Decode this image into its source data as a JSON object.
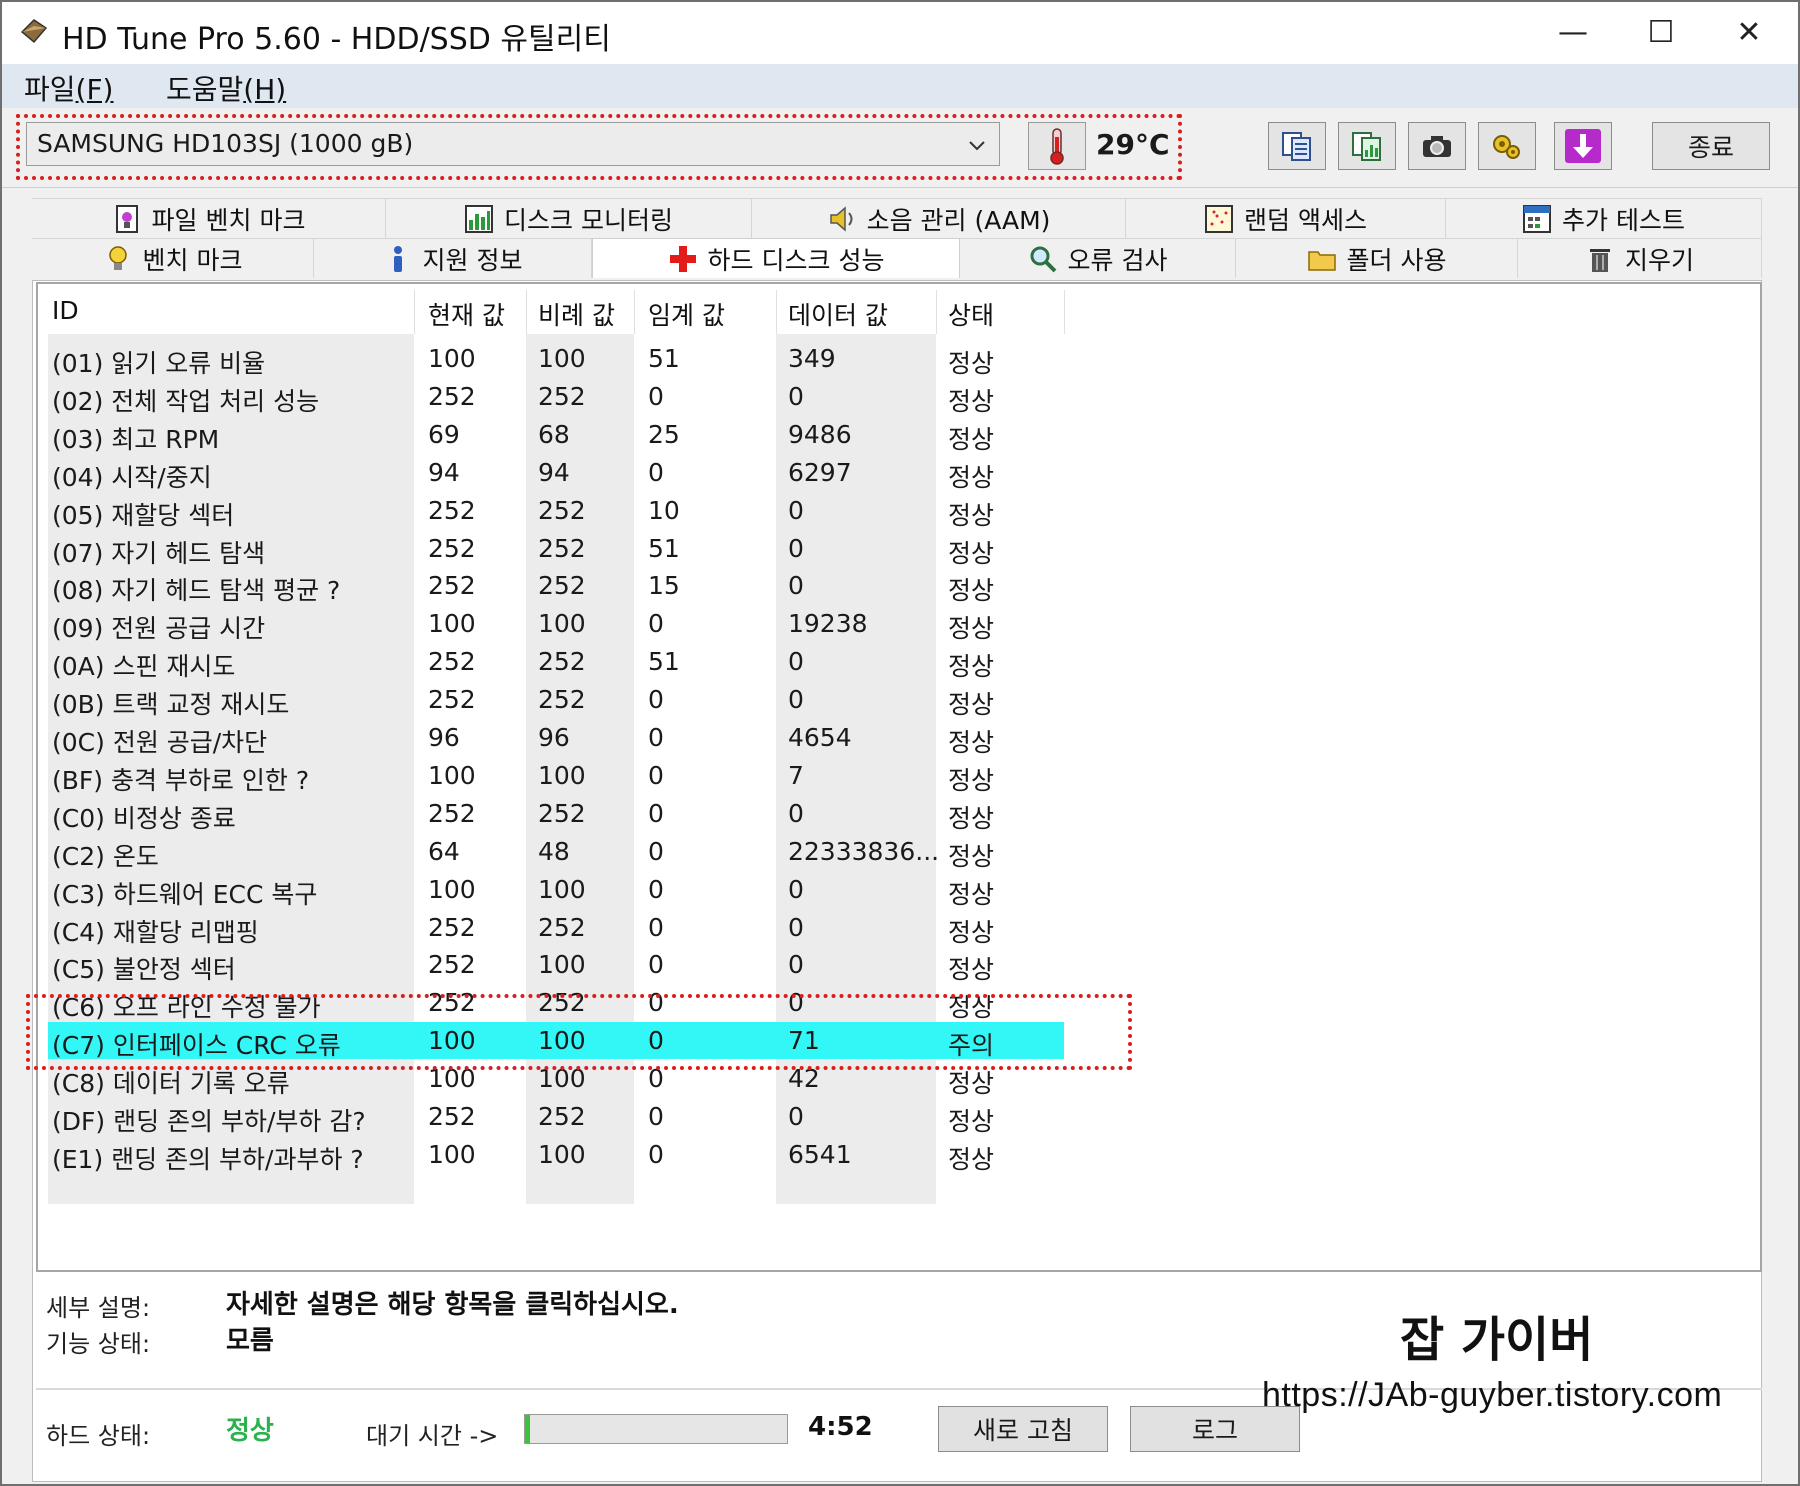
{
  "window": {
    "title": "HD Tune Pro 5.60 - HDD/SSD  유틸리티",
    "minimize": "—",
    "maximize": "☐",
    "close": "✕"
  },
  "menu": [
    {
      "label": "파일",
      "accel": "(F)"
    },
    {
      "label": "도움말",
      "accel": "(H)"
    }
  ],
  "toolbar": {
    "drive": "SAMSUNG HD103SJ (1000 gB)",
    "temperature": "29°C",
    "exit_label": "종료",
    "icons": [
      "copy-info-icon",
      "copy-screen-icon",
      "screenshot-icon",
      "options-icon",
      "save-download-icon"
    ]
  },
  "tabs_row1": [
    {
      "label": "파일 벤치 마크",
      "icon": "file-benchmark-icon"
    },
    {
      "label": "디스크 모니터링",
      "icon": "disk-monitor-icon"
    },
    {
      "label": "소음 관리 (AAM)",
      "icon": "speaker-icon"
    },
    {
      "label": "랜덤 액세스",
      "icon": "random-access-icon"
    },
    {
      "label": "추가 테스트",
      "icon": "extra-tests-icon"
    }
  ],
  "tabs_row2": [
    {
      "label": "벤치 마크",
      "icon": "lightbulb-icon"
    },
    {
      "label": "지원 정보",
      "icon": "info-icon"
    },
    {
      "label": "하드 디스크 성능",
      "icon": "health-cross-icon",
      "active": true
    },
    {
      "label": "오류 검사",
      "icon": "magnifier-icon"
    },
    {
      "label": "폴더 사용",
      "icon": "folder-icon"
    },
    {
      "label": "지우기",
      "icon": "trash-icon"
    }
  ],
  "table": {
    "headers": [
      "ID",
      "현재 값",
      "비례 값",
      "임계 값",
      "데이터 값",
      "상태"
    ],
    "rows": [
      [
        "(01) 읽기 오류 비율",
        "100",
        "100",
        "51",
        "349",
        "정상"
      ],
      [
        "(02) 전체 작업 처리 성능",
        "252",
        "252",
        "0",
        "0",
        "정상"
      ],
      [
        "(03) 최고 RPM",
        "69",
        "68",
        "25",
        "9486",
        "정상"
      ],
      [
        "(04) 시작/중지",
        "94",
        "94",
        "0",
        "6297",
        "정상"
      ],
      [
        "(05) 재할당 섹터",
        "252",
        "252",
        "10",
        "0",
        "정상"
      ],
      [
        "(07) 자기 헤드 탐색",
        "252",
        "252",
        "51",
        "0",
        "정상"
      ],
      [
        "(08) 자기 헤드 탐색 평균 ?",
        "252",
        "252",
        "15",
        "0",
        "정상"
      ],
      [
        "(09) 전원 공급 시간",
        "100",
        "100",
        "0",
        "19238",
        "정상"
      ],
      [
        "(0A) 스핀 재시도",
        "252",
        "252",
        "51",
        "0",
        "정상"
      ],
      [
        "(0B) 트랙 교정 재시도",
        "252",
        "252",
        "0",
        "0",
        "정상"
      ],
      [
        "(0C) 전원 공급/차단",
        "96",
        "96",
        "0",
        "4654",
        "정상"
      ],
      [
        "(BF) 충격 부하로 인한 ?",
        "100",
        "100",
        "0",
        "7",
        "정상"
      ],
      [
        "(C0) 비정상 종료",
        "252",
        "252",
        "0",
        "0",
        "정상"
      ],
      [
        "(C2) 온도",
        "64",
        "48",
        "0",
        "22333836...",
        "정상"
      ],
      [
        "(C3) 하드웨어 ECC 복구",
        "100",
        "100",
        "0",
        "0",
        "정상"
      ],
      [
        "(C4) 재할당 리맵핑",
        "252",
        "252",
        "0",
        "0",
        "정상"
      ],
      [
        "(C5) 불안정 섹터",
        "252",
        "100",
        "0",
        "0",
        "정상"
      ],
      [
        "(C6) 오프 라인 수정 불가",
        "252",
        "252",
        "0",
        "0",
        "정상"
      ],
      [
        "(C7) 인터페이스 CRC 오류",
        "100",
        "100",
        "0",
        "71",
        "주의"
      ],
      [
        "(C8) 데이터 기록 오류",
        "100",
        "100",
        "0",
        "42",
        "정상"
      ],
      [
        "(DF) 랜딩 존의 부하/부하 감?",
        "252",
        "252",
        "0",
        "0",
        "정상"
      ],
      [
        "(E1) 랜딩 존의 부하/과부하 ?",
        "100",
        "100",
        "0",
        "6541",
        "정상"
      ]
    ],
    "highlighted_row": 18,
    "highlight_color": "#33f6f6"
  },
  "details": {
    "desc_label": "세부 설명:",
    "desc_value": "자세한 설명은 해당 항목을 클릭하십시오.",
    "func_label": "기능 상태:",
    "func_value": "모름"
  },
  "status": {
    "health_label": "하드 상태:",
    "health_value": "정상",
    "health_color": "#2bb24c",
    "wait_label": "대기 시간 ->",
    "wait_progress": 0.02,
    "countdown": "4:52",
    "refresh_label": "새로 고침",
    "log_label": "로그"
  },
  "watermark": {
    "title": "잡 가이버",
    "url": "https://JAb-guyber.tistory.com"
  }
}
